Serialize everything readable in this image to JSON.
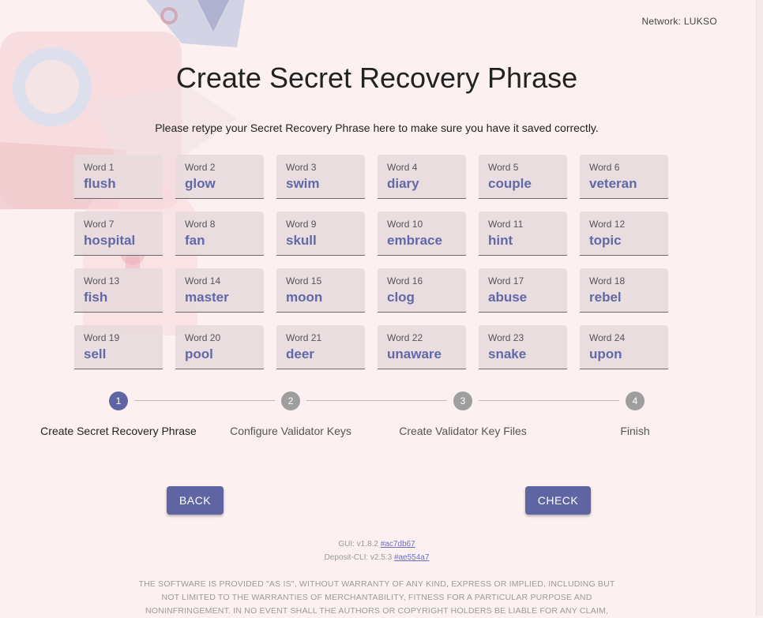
{
  "network": {
    "label": "Network: LUKSO"
  },
  "title": "Create Secret Recovery Phrase",
  "subtitle": "Please retype your Secret Recovery Phrase here to make sure you have it saved correctly.",
  "words": [
    {
      "label": "Word 1",
      "value": "flush"
    },
    {
      "label": "Word 2",
      "value": "glow"
    },
    {
      "label": "Word 3",
      "value": "swim"
    },
    {
      "label": "Word 4",
      "value": "diary"
    },
    {
      "label": "Word 5",
      "value": "couple"
    },
    {
      "label": "Word 6",
      "value": "veteran"
    },
    {
      "label": "Word 7",
      "value": "hospital"
    },
    {
      "label": "Word 8",
      "value": "fan"
    },
    {
      "label": "Word 9",
      "value": "skull"
    },
    {
      "label": "Word 10",
      "value": "embrace"
    },
    {
      "label": "Word 11",
      "value": "hint"
    },
    {
      "label": "Word 12",
      "value": "topic"
    },
    {
      "label": "Word 13",
      "value": "fish"
    },
    {
      "label": "Word 14",
      "value": "master"
    },
    {
      "label": "Word 15",
      "value": "moon"
    },
    {
      "label": "Word 16",
      "value": "clog"
    },
    {
      "label": "Word 17",
      "value": "abuse"
    },
    {
      "label": "Word 18",
      "value": "rebel"
    },
    {
      "label": "Word 19",
      "value": "sell"
    },
    {
      "label": "Word 20",
      "value": "pool"
    },
    {
      "label": "Word 21",
      "value": "deer"
    },
    {
      "label": "Word 22",
      "value": "unaware"
    },
    {
      "label": "Word 23",
      "value": "snake"
    },
    {
      "label": "Word 24",
      "value": "upon"
    }
  ],
  "stepper": {
    "steps": [
      {
        "number": "1",
        "label": "Create Secret Recovery Phrase",
        "active": true
      },
      {
        "number": "2",
        "label": "Configure Validator Keys",
        "active": false
      },
      {
        "number": "3",
        "label": "Create Validator Key Files",
        "active": false
      },
      {
        "number": "4",
        "label": "Finish",
        "active": false
      }
    ]
  },
  "buttons": {
    "back": "BACK",
    "check": "CHECK"
  },
  "footer": {
    "gui_prefix": "GUI: v1.8.2",
    "gui_hash": "#ac7db67",
    "cli_prefix": "Deposit-CLI: v2.5.3",
    "cli_hash": "#ae554a7",
    "license_lines": [
      "THE SOFTWARE IS PROVIDED \"AS IS\", WITHOUT WARRANTY OF ANY KIND, EXPRESS OR IMPLIED, INCLUDING BUT",
      "NOT LIMITED TO THE WARRANTIES OF MERCHANTABILITY, FITNESS FOR A PARTICULAR PURPOSE AND",
      "NONINFRINGEMENT. IN NO EVENT SHALL THE AUTHORS OR COPYRIGHT HOLDERS BE LIABLE FOR ANY CLAIM,"
    ]
  },
  "colors": {
    "accent": "#5f65a3",
    "background": "#fcf0f0",
    "word_value": "#6068a8",
    "inactive_step": "#9e9e9e"
  }
}
